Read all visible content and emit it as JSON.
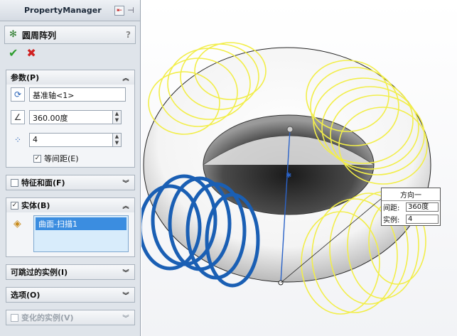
{
  "property_manager": {
    "title": "PropertyManager",
    "feature_title": "圆周阵列",
    "help": "?"
  },
  "parameters": {
    "header": "参数(P)",
    "axis_value": "基准轴<1>",
    "angle_value": "360.00度",
    "count_value": "4",
    "equal_spacing_label": "等间距(E)",
    "equal_spacing_checked": true
  },
  "sections": {
    "features_faces": "特征和面(F)",
    "bodies": "实体(B)",
    "bodies_item": "曲面-扫描1",
    "skippable_instances": "可跳过的实例(I)",
    "options": "选项(O)",
    "varying_instances": "变化的实例(V)"
  },
  "tooltip": {
    "title": "方向一",
    "spacing_label": "间距:",
    "spacing_value": "360度",
    "instances_label": "实例:",
    "instances_value": "4"
  },
  "colors": {
    "selected_body": "#1a5fb4",
    "preview": "#f2ee4a",
    "torus": "#ffffff"
  }
}
